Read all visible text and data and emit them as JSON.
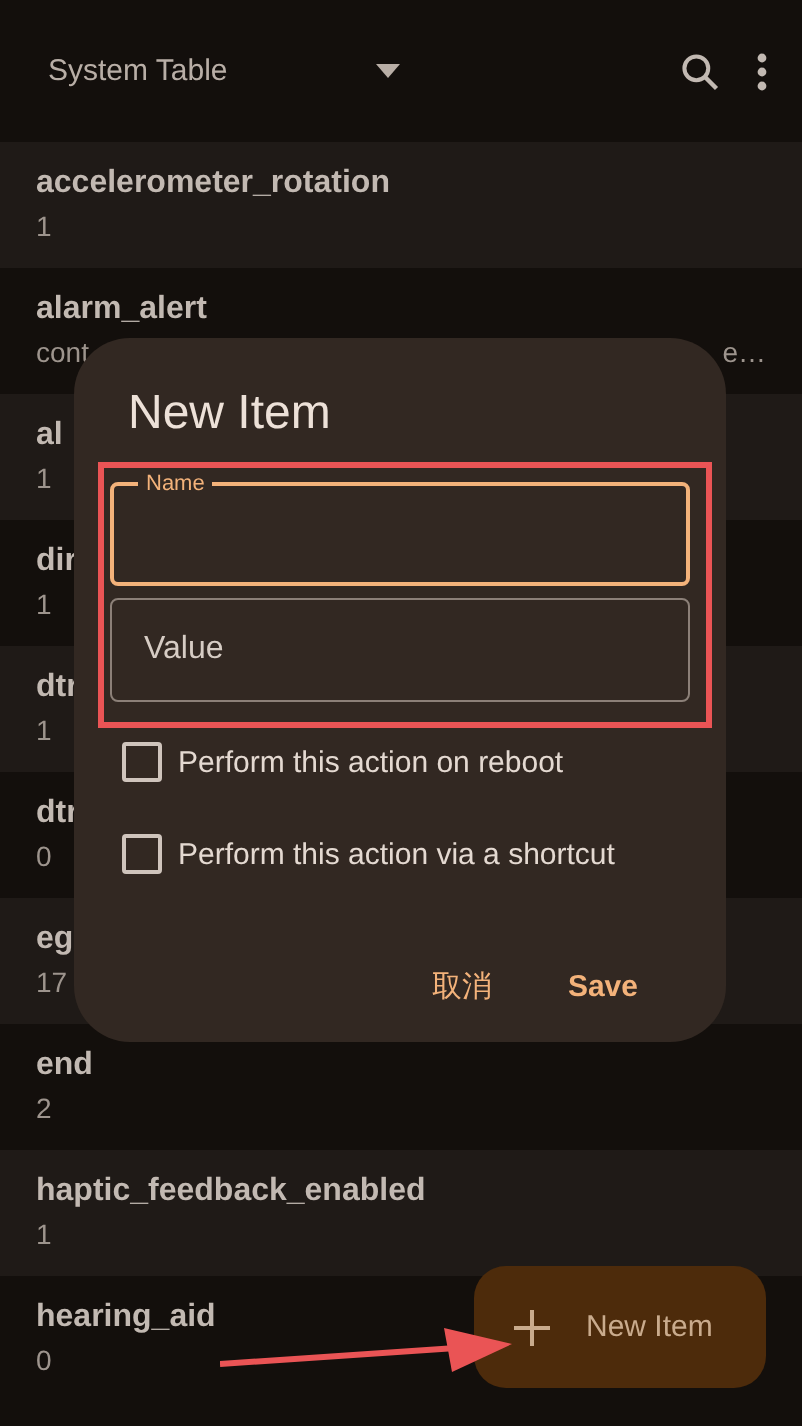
{
  "toolbar": {
    "title": "System Table"
  },
  "rows": [
    {
      "name": "accelerometer_rotation",
      "value": "1"
    },
    {
      "name": "alarm_alert",
      "value": "cont",
      "value_tail": "e…"
    },
    {
      "name": "al",
      "value": "1"
    },
    {
      "name": "dir",
      "value": "1"
    },
    {
      "name": "dtr",
      "value": "1"
    },
    {
      "name": "dtr",
      "value": "0"
    },
    {
      "name": "eg",
      "value": "17"
    },
    {
      "name": "end",
      "value": "2"
    },
    {
      "name": "haptic_feedback_enabled",
      "value": "1"
    },
    {
      "name": "hearing_aid",
      "value": "0"
    }
  ],
  "dialog": {
    "title": "New Item",
    "fields": [
      {
        "label": "Name",
        "focused": true
      },
      {
        "placeholder": "Value",
        "focused": false
      }
    ],
    "checkboxes": [
      {
        "label": "Perform this action on reboot",
        "checked": false
      },
      {
        "label": "Perform this action via a shortcut",
        "checked": false
      }
    ],
    "buttons": [
      {
        "label": "取消",
        "bold": false
      },
      {
        "label": "Save",
        "bold": true
      }
    ]
  },
  "fab": {
    "label": "New Item"
  }
}
